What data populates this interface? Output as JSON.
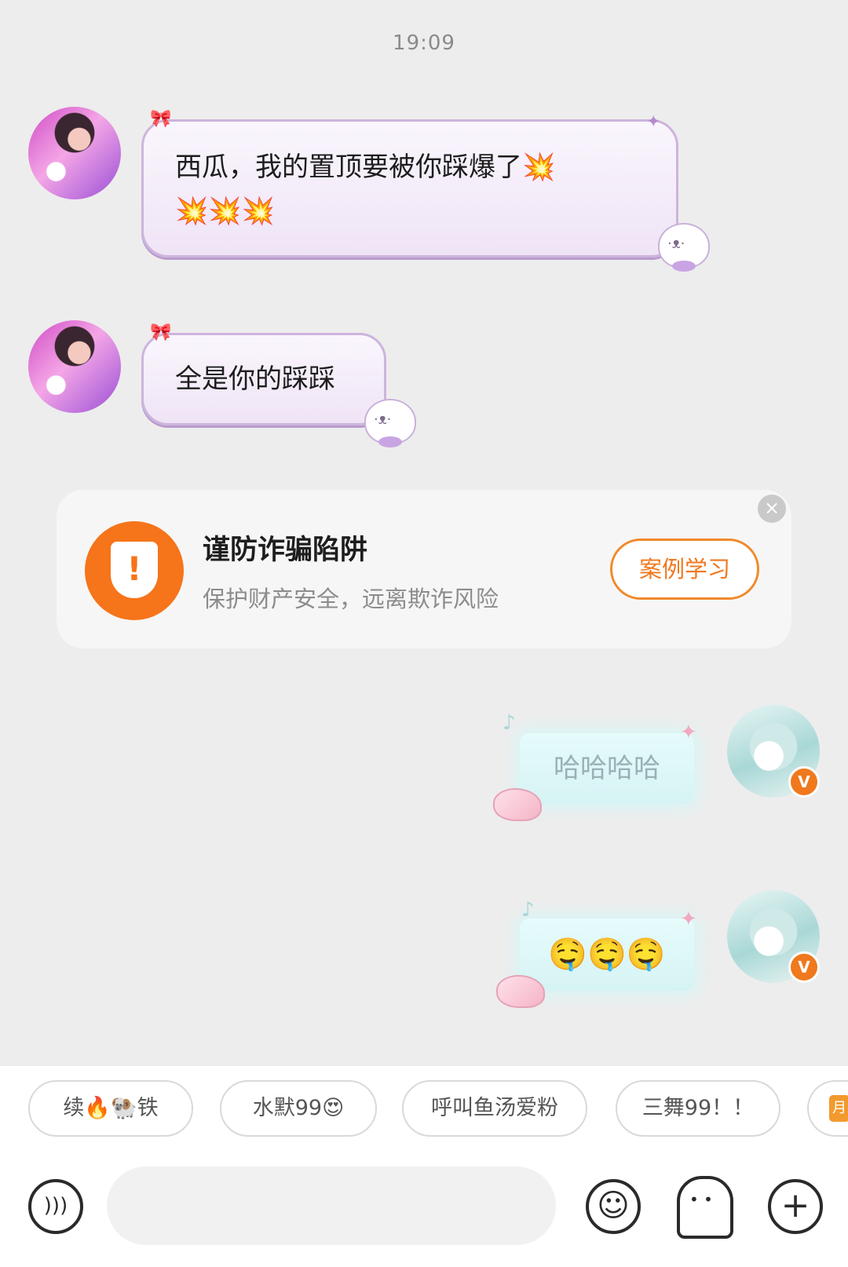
{
  "chat": {
    "timestamp": "19:09",
    "messages": [
      {
        "side": "left",
        "line1": "西瓜，我的置顶要被你踩爆了💥",
        "line2": "💥💥💥"
      },
      {
        "side": "left",
        "text": "全是你的踩踩"
      },
      {
        "side": "right",
        "text": "哈哈哈哈",
        "vip": "V"
      },
      {
        "side": "right",
        "emoji": "🤤🤤🤤",
        "vip": "V"
      }
    ]
  },
  "warning_card": {
    "title": "谨防诈骗陷阱",
    "subtitle": "保护财产安全，远离欺诈风险",
    "button": "案例学习",
    "icon": "shield-alert-icon",
    "shield_mark": "!",
    "close": "×",
    "accent": "#f6741a"
  },
  "quick_replies": [
    "续🔥🐏铁",
    "水默99😍",
    "呼叫鱼汤爱粉",
    "三舞99！！"
  ],
  "quick_reply_partial_label": "月",
  "input_bar": {
    "placeholder": "",
    "voice_icon": "voice-icon",
    "emoji_icon": "emoji-icon",
    "sticker_icon": "sticker-icon",
    "plus_icon": "plus-icon",
    "voice_glyph": ")))",
    "emoji_glyph": "☺",
    "plus_glyph": "+"
  }
}
